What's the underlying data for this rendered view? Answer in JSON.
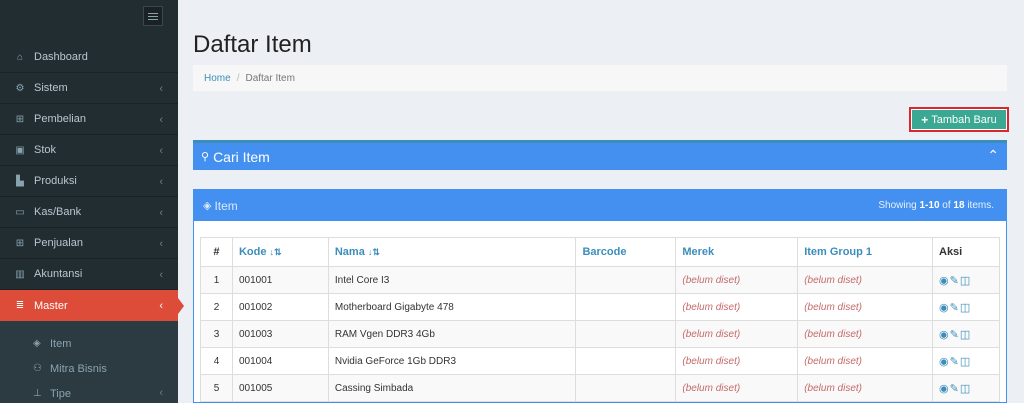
{
  "sidebar": {
    "menu": [
      {
        "label": "Dashboard",
        "icon": "home-icon",
        "glyph": "⌂",
        "chevron": ""
      },
      {
        "label": "Sistem",
        "icon": "gears-icon",
        "glyph": "⚙",
        "chevron": "‹"
      },
      {
        "label": "Pembelian",
        "icon": "cart-icon",
        "glyph": "⊞",
        "chevron": "‹"
      },
      {
        "label": "Stok",
        "icon": "box-icon",
        "glyph": "▣",
        "chevron": "‹"
      },
      {
        "label": "Produksi",
        "icon": "industry-icon",
        "glyph": "▙",
        "chevron": "‹"
      },
      {
        "label": "Kas/Bank",
        "icon": "money-icon",
        "glyph": "▭",
        "chevron": "‹"
      },
      {
        "label": "Penjualan",
        "icon": "shopping-cart-icon",
        "glyph": "⊞",
        "chevron": "‹"
      },
      {
        "label": "Akuntansi",
        "icon": "bar-chart-icon",
        "glyph": "▥",
        "chevron": "‹"
      },
      {
        "label": "Master",
        "icon": "database-icon",
        "glyph": "≣",
        "chevron": "‹"
      }
    ],
    "submenu": [
      {
        "label": "Item",
        "icon": "cube-icon",
        "glyph": "◈",
        "chevron": ""
      },
      {
        "label": "Mitra Bisnis",
        "icon": "users-icon",
        "glyph": "⚇",
        "chevron": ""
      },
      {
        "label": "Tipe",
        "icon": "sitemap-icon",
        "glyph": "⊥",
        "chevron": "‹"
      }
    ]
  },
  "page": {
    "title": "Daftar Item",
    "breadcrumb": {
      "home": "Home",
      "separator": "/",
      "current": "Daftar Item"
    },
    "add_button": "Tambah Baru"
  },
  "search": {
    "title": "Cari Item",
    "collapse_glyph": "⌃"
  },
  "item_box": {
    "title": "Item",
    "showing_prefix": "Showing ",
    "showing_range": "1-10",
    "showing_of": " of ",
    "showing_total": "18",
    "showing_suffix": " items."
  },
  "table": {
    "headers": {
      "num": "#",
      "kode": "Kode",
      "nama": "Nama",
      "barcode": "Barcode",
      "merek": "Merek",
      "group": "Item Group 1",
      "aksi": "Aksi"
    },
    "sort_glyph": "↓⇅",
    "action_glyphs": "👁✎🗑",
    "rows": [
      {
        "num": "1",
        "kode": "001001",
        "nama": "Intel Core I3",
        "barcode": "",
        "merek": "(belum diset)",
        "group": "(belum diset)"
      },
      {
        "num": "2",
        "kode": "001002",
        "nama": "Motherboard Gigabyte 478",
        "barcode": "",
        "merek": "(belum diset)",
        "group": "(belum diset)"
      },
      {
        "num": "3",
        "kode": "001003",
        "nama": "RAM Vgen DDR3 4Gb",
        "barcode": "",
        "merek": "(belum diset)",
        "group": "(belum diset)"
      },
      {
        "num": "4",
        "kode": "001004",
        "nama": "Nvidia GeForce 1Gb DDR3",
        "barcode": "",
        "merek": "(belum diset)",
        "group": "(belum diset)"
      },
      {
        "num": "5",
        "kode": "001005",
        "nama": "Cassing Simbada",
        "barcode": "",
        "merek": "(belum diset)",
        "group": "(belum diset)"
      }
    ]
  },
  "colors": {
    "sidebar": "#222d32",
    "active": "#dd4b39",
    "primary": "#4390f0",
    "success": "#3aa892",
    "highlight": "#d9272e",
    "unset": "#c46a68"
  }
}
